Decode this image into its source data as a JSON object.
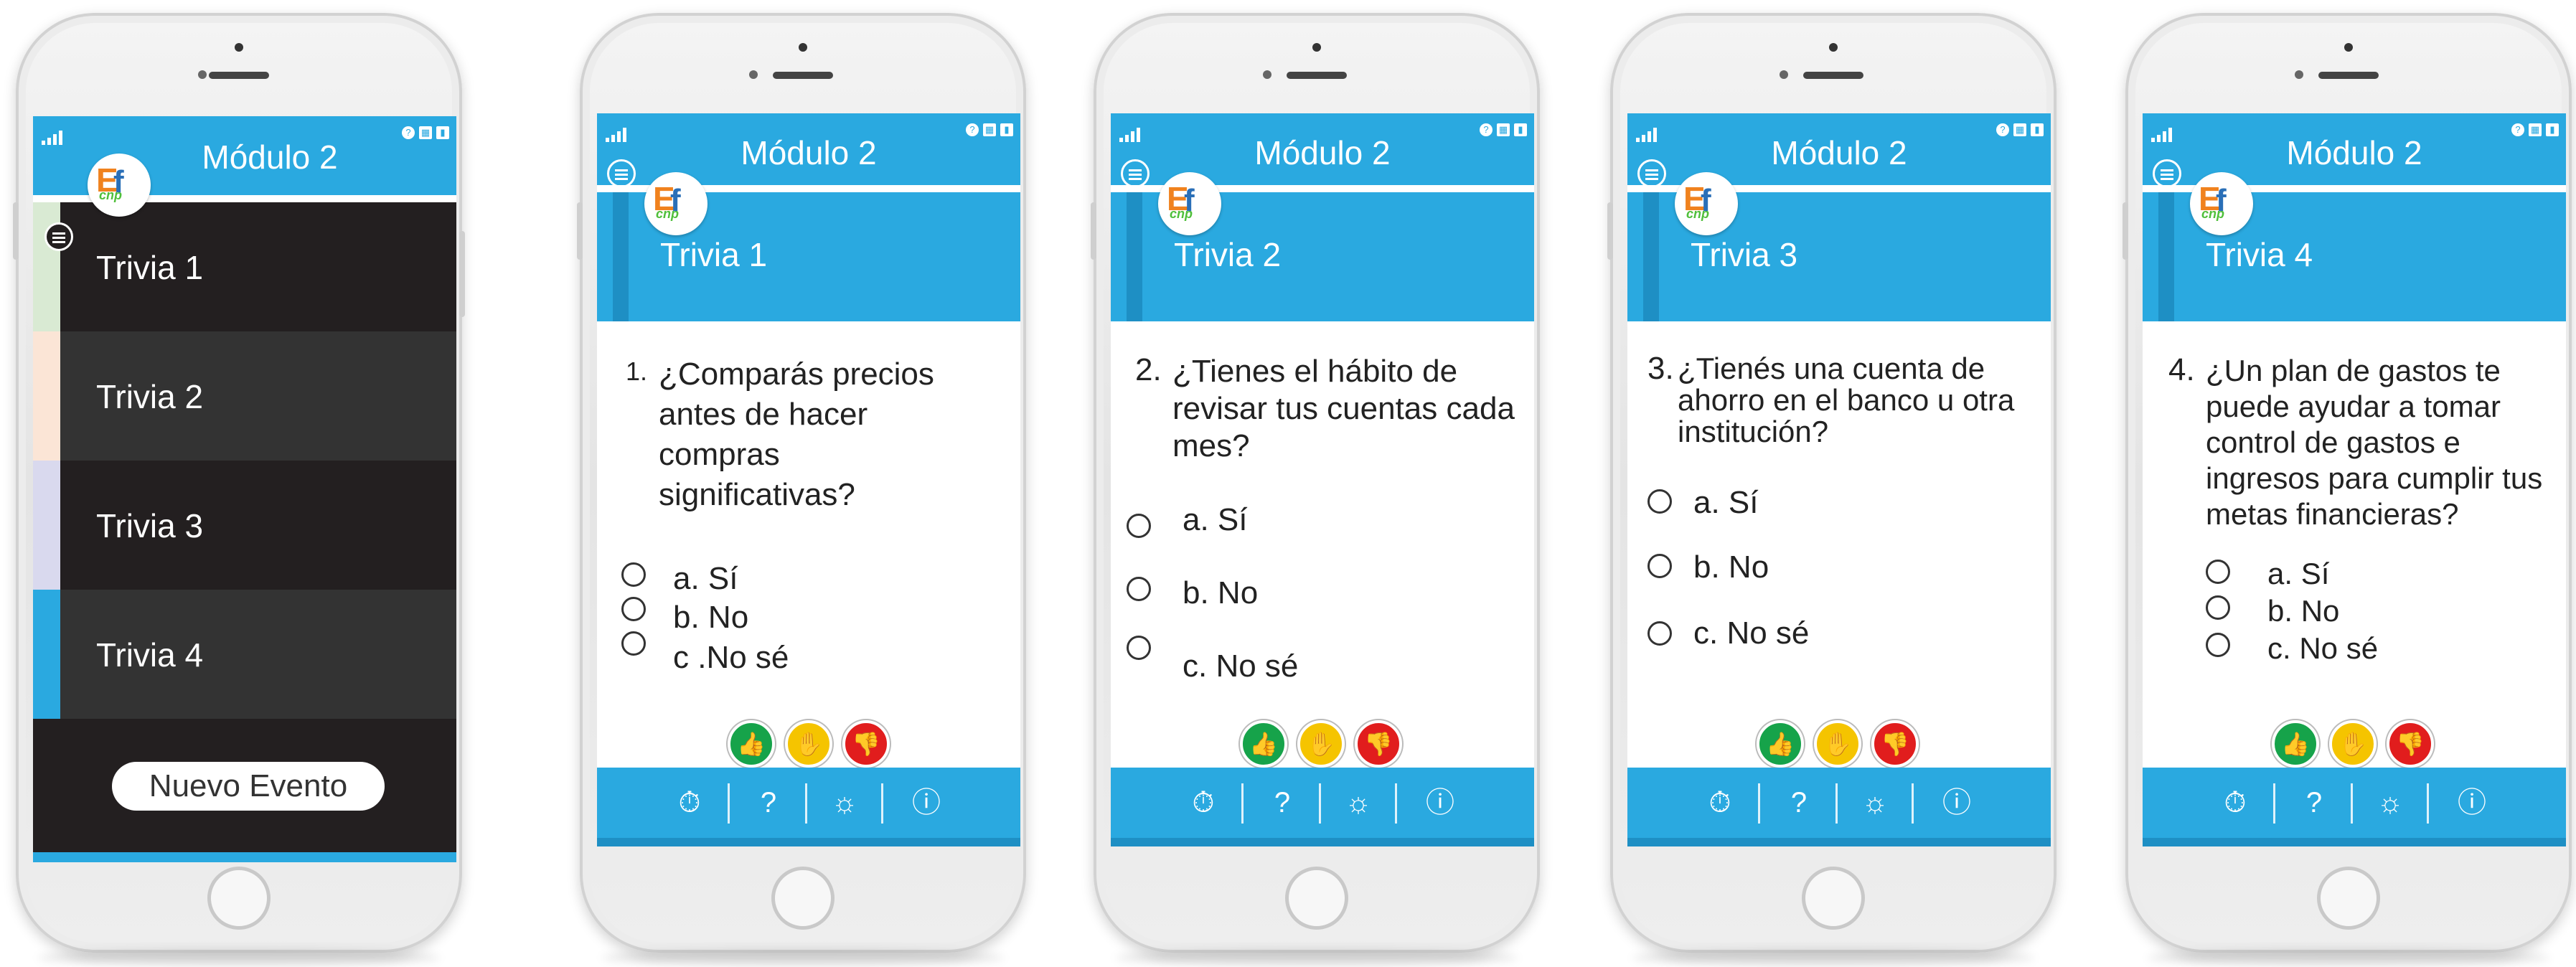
{
  "colors": {
    "primary": "#2aa9e0",
    "primary_dark": "#1e8fc4",
    "menu_dark": "#231f20",
    "menu_mid": "#333333",
    "like": "#16a34a",
    "neutral": "#f5c400",
    "dislike": "#e11d1d"
  },
  "app": {
    "title": "Módulo 2"
  },
  "menu": {
    "items": [
      {
        "label": "Trivia 1",
        "accent": "#d9ead3"
      },
      {
        "label": "Trivia 2",
        "accent": "#fbe5d6"
      },
      {
        "label": "Trivia 3",
        "accent": "#d9d9ee"
      },
      {
        "label": "Trivia 4",
        "accent": "#2aa9e0"
      }
    ],
    "new_event_label": "Nuevo Evento"
  },
  "screens": [
    {
      "title": "Trivia 1",
      "number": "1.",
      "question": "¿Comparás precios antes de hacer compras significativas?",
      "options": [
        "a. Sí",
        "b. No",
        "c .No sé"
      ]
    },
    {
      "title": "Trivia 2",
      "number": "2.",
      "question": "¿Tienes el hábito de revisar tus cuentas cada mes?",
      "options": [
        "a. Sí",
        "b. No",
        "c. No sé"
      ]
    },
    {
      "title": "Trivia 3",
      "number": "3.",
      "question": "¿Tienés una cuenta de ahorro en el banco u otra institución?",
      "options": [
        "a. Sí",
        "b. No",
        "c. No sé"
      ]
    },
    {
      "title": "Trivia 4",
      "number": "4.",
      "question": "¿Un plan de gastos te puede ayudar a tomar control de gastos e ingresos para cumplir tus metas financieras?",
      "options": [
        "a. Sí",
        "b. No",
        "c. No sé"
      ]
    }
  ],
  "reactions": [
    "thumbs-up-icon",
    "hand-icon",
    "thumbs-down-icon"
  ],
  "bottom_nav": [
    "stopwatch-icon",
    "help-icon",
    "lightbulb-icon",
    "info-icon"
  ]
}
